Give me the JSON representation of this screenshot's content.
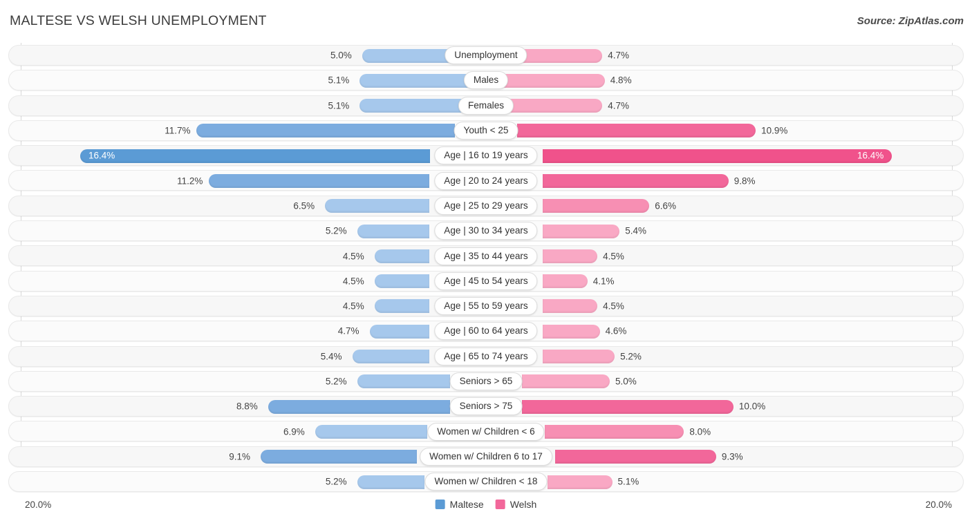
{
  "header": {
    "title": "MALTESE VS WELSH UNEMPLOYMENT",
    "source": "Source: ZipAtlas.com"
  },
  "axis": {
    "left_label": "20.0%",
    "right_label": "20.0%",
    "max": 20.0
  },
  "legend": {
    "items": [
      {
        "label": "Maltese",
        "color": "#5b9bd5"
      },
      {
        "label": "Welsh",
        "color": "#f2679a"
      }
    ]
  },
  "colors": {
    "blue_light": "#a6c8ec",
    "blue_mid": "#7cacdf",
    "blue_strong": "#5b9bd5",
    "pink_light": "#f9a8c4",
    "pink_mid": "#f78fb3",
    "pink_strong": "#f2679a",
    "track": "#f7f7f7",
    "gridline": "#d8d8d8"
  },
  "chart_data": {
    "type": "bar",
    "title": "MALTESE VS WELSH UNEMPLOYMENT",
    "subtitle": "",
    "xlabel": "",
    "ylabel": "",
    "orientation": "horizontal-diverging",
    "xlim": [
      20.0,
      20.0
    ],
    "grid": true,
    "legend_position": "bottom-center",
    "series": [
      {
        "name": "Maltese",
        "color": "#5b9bd5",
        "values": [
          5.0,
          5.1,
          5.1,
          11.7,
          16.4,
          11.2,
          6.5,
          5.2,
          4.5,
          4.5,
          4.5,
          4.7,
          5.4,
          5.2,
          8.8,
          6.9,
          9.1,
          5.2
        ]
      },
      {
        "name": "Welsh",
        "color": "#f2679a",
        "values": [
          4.7,
          4.8,
          4.7,
          10.9,
          16.4,
          9.8,
          6.6,
          5.4,
          4.5,
          4.1,
          4.5,
          4.6,
          5.2,
          5.0,
          10.0,
          8.0,
          9.3,
          5.1
        ]
      }
    ],
    "categories": [
      "Unemployment",
      "Males",
      "Females",
      "Youth < 25",
      "Age | 16 to 19 years",
      "Age | 20 to 24 years",
      "Age | 25 to 29 years",
      "Age | 30 to 34 years",
      "Age | 35 to 44 years",
      "Age | 45 to 54 years",
      "Age | 55 to 59 years",
      "Age | 60 to 64 years",
      "Age | 65 to 74 years",
      "Seniors > 65",
      "Seniors > 75",
      "Women w/ Children < 6",
      "Women w/ Children 6 to 17",
      "Women w/ Children < 18"
    ]
  },
  "rows": [
    {
      "label": "Unemployment",
      "left_value": "5.0%",
      "right_value": "4.7%",
      "left_num": 5.0,
      "right_num": 4.7,
      "left_color": "#a6c8ec",
      "right_color": "#f9a8c4",
      "label_inside": false
    },
    {
      "label": "Males",
      "left_value": "5.1%",
      "right_value": "4.8%",
      "left_num": 5.1,
      "right_num": 4.8,
      "left_color": "#a6c8ec",
      "right_color": "#f9a8c4",
      "label_inside": false
    },
    {
      "label": "Females",
      "left_value": "5.1%",
      "right_value": "4.7%",
      "left_num": 5.1,
      "right_num": 4.7,
      "left_color": "#a6c8ec",
      "right_color": "#f9a8c4",
      "label_inside": false
    },
    {
      "label": "Youth < 25",
      "left_value": "11.7%",
      "right_value": "10.9%",
      "left_num": 11.7,
      "right_num": 10.9,
      "left_color": "#7cacdf",
      "right_color": "#f2679a",
      "label_inside": false
    },
    {
      "label": "Age | 16 to 19 years",
      "left_value": "16.4%",
      "right_value": "16.4%",
      "left_num": 16.4,
      "right_num": 16.4,
      "left_color": "#5b9bd5",
      "right_color": "#f0528b",
      "label_inside": true
    },
    {
      "label": "Age | 20 to 24 years",
      "left_value": "11.2%",
      "right_value": "9.8%",
      "left_num": 11.2,
      "right_num": 9.8,
      "left_color": "#7cacdf",
      "right_color": "#f2679a",
      "label_inside": false
    },
    {
      "label": "Age | 25 to 29 years",
      "left_value": "6.5%",
      "right_value": "6.6%",
      "left_num": 6.5,
      "right_num": 6.6,
      "left_color": "#a6c8ec",
      "right_color": "#f78fb3",
      "label_inside": false
    },
    {
      "label": "Age | 30 to 34 years",
      "left_value": "5.2%",
      "right_value": "5.4%",
      "left_num": 5.2,
      "right_num": 5.4,
      "left_color": "#a6c8ec",
      "right_color": "#f9a8c4",
      "label_inside": false
    },
    {
      "label": "Age | 35 to 44 years",
      "left_value": "4.5%",
      "right_value": "4.5%",
      "left_num": 4.5,
      "right_num": 4.5,
      "left_color": "#a6c8ec",
      "right_color": "#f9a8c4",
      "label_inside": false
    },
    {
      "label": "Age | 45 to 54 years",
      "left_value": "4.5%",
      "right_value": "4.1%",
      "left_num": 4.5,
      "right_num": 4.1,
      "left_color": "#a6c8ec",
      "right_color": "#f9a8c4",
      "label_inside": false
    },
    {
      "label": "Age | 55 to 59 years",
      "left_value": "4.5%",
      "right_value": "4.5%",
      "left_num": 4.5,
      "right_num": 4.5,
      "left_color": "#a6c8ec",
      "right_color": "#f9a8c4",
      "label_inside": false
    },
    {
      "label": "Age | 60 to 64 years",
      "left_value": "4.7%",
      "right_value": "4.6%",
      "left_num": 4.7,
      "right_num": 4.6,
      "left_color": "#a6c8ec",
      "right_color": "#f9a8c4",
      "label_inside": false
    },
    {
      "label": "Age | 65 to 74 years",
      "left_value": "5.4%",
      "right_value": "5.2%",
      "left_num": 5.4,
      "right_num": 5.2,
      "left_color": "#a6c8ec",
      "right_color": "#f9a8c4",
      "label_inside": false
    },
    {
      "label": "Seniors > 65",
      "left_value": "5.2%",
      "right_value": "5.0%",
      "left_num": 5.2,
      "right_num": 5.0,
      "left_color": "#a6c8ec",
      "right_color": "#f9a8c4",
      "label_inside": false
    },
    {
      "label": "Seniors > 75",
      "left_value": "8.8%",
      "right_value": "10.0%",
      "left_num": 8.8,
      "right_num": 10.0,
      "left_color": "#7cacdf",
      "right_color": "#f2679a",
      "label_inside": false
    },
    {
      "label": "Women w/ Children < 6",
      "left_value": "6.9%",
      "right_value": "8.0%",
      "left_num": 6.9,
      "right_num": 8.0,
      "left_color": "#a6c8ec",
      "right_color": "#f78fb3",
      "label_inside": false
    },
    {
      "label": "Women w/ Children 6 to 17",
      "left_value": "9.1%",
      "right_value": "9.3%",
      "left_num": 9.1,
      "right_num": 9.3,
      "left_color": "#7cacdf",
      "right_color": "#f2679a",
      "label_inside": false
    },
    {
      "label": "Women w/ Children < 18",
      "left_value": "5.2%",
      "right_value": "5.1%",
      "left_num": 5.2,
      "right_num": 5.1,
      "left_color": "#a6c8ec",
      "right_color": "#f9a8c4",
      "label_inside": false
    }
  ]
}
